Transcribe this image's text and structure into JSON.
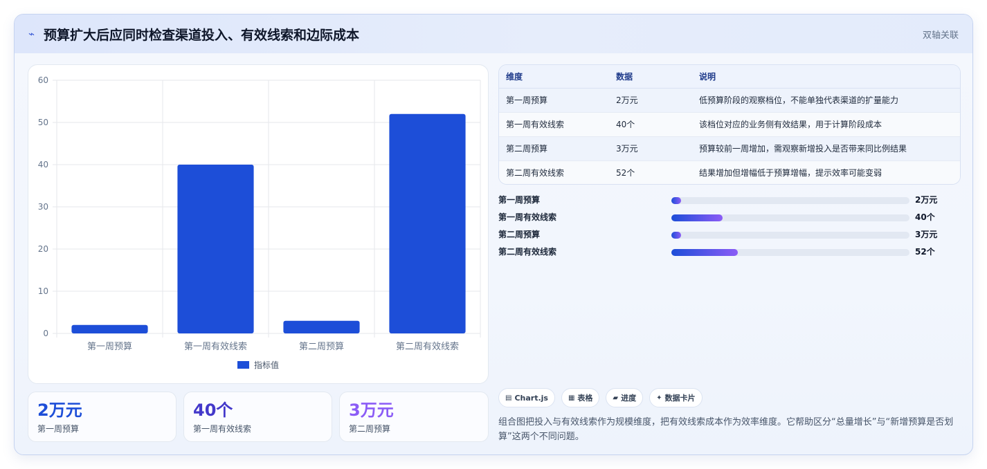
{
  "header": {
    "icon": "sparkle-icon",
    "title": "预算扩大后应同时检查渠道投入、有效线索和边际成本",
    "tag": "双轴关联"
  },
  "chart_data": {
    "type": "bar",
    "categories": [
      "第一周预算",
      "第一周有效线索",
      "第二周预算",
      "第二周有效线索"
    ],
    "series": [
      {
        "name": "指标值",
        "values": [
          2,
          40,
          3,
          52
        ],
        "color": "#1d4ed8"
      }
    ],
    "ylim": [
      0,
      60
    ],
    "yticks": [
      0,
      10,
      20,
      30,
      40,
      50,
      60
    ],
    "grid": true,
    "legend": "bottom"
  },
  "stats": [
    {
      "value": "2万元",
      "label": "第一周预算",
      "color": "#1d4ed8"
    },
    {
      "value": "40个",
      "label": "第一周有效线索",
      "color": "#4338ca"
    },
    {
      "value": "3万元",
      "label": "第二周预算",
      "color": "#8b5cf6"
    }
  ],
  "table": {
    "headers": [
      "维度",
      "数据",
      "说明"
    ],
    "rows": [
      [
        "第一周预算",
        "2万元",
        "低预算阶段的观察档位，不能单独代表渠道的扩量能力"
      ],
      [
        "第一周有效线索",
        "40个",
        "该档位对应的业务侧有效结果，用于计算阶段成本"
      ],
      [
        "第二周预算",
        "3万元",
        "预算较前一周增加，需观察新增投入是否带来同比例结果"
      ],
      [
        "第二周有效线索",
        "52个",
        "结果增加但增幅低于预算增幅，提示效率可能变弱"
      ]
    ]
  },
  "progress": [
    {
      "label": "第一周预算",
      "value": "2万元",
      "fraction": 0.04
    },
    {
      "label": "第一周有效线索",
      "value": "40个",
      "fraction": 0.215
    },
    {
      "label": "第二周预算",
      "value": "3万元",
      "fraction": 0.04
    },
    {
      "label": "第二周有效线索",
      "value": "52个",
      "fraction": 0.28
    }
  ],
  "chips": [
    {
      "icon": "chart-icon",
      "label": "Chart.js"
    },
    {
      "icon": "table-icon",
      "label": "表格"
    },
    {
      "icon": "progress-icon",
      "label": "进度"
    },
    {
      "icon": "card-icon",
      "label": "数据卡片"
    }
  ],
  "description": "组合图把投入与有效线索作为规模维度，把有效线索成本作为效率维度。它帮助区分“总量增长”与“新增预算是否划算”这两个不同问题。"
}
